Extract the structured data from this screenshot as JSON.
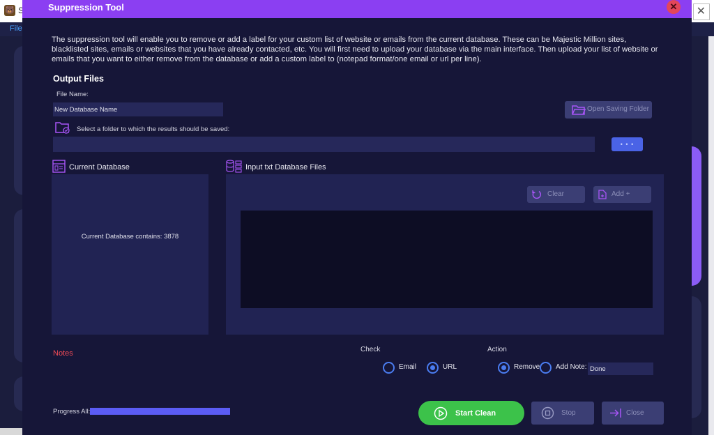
{
  "background_app": {
    "title_initial": "S",
    "menu_file": "File"
  },
  "dialog": {
    "title": "Suppression Tool",
    "description": "The suppression tool will enable you to remove or add a label for your custom list of website or emails from the current database. These can be Majestic Million sites, blacklisted sites, emails or websites that you have already contacted, etc. You will first need to upload your database via the main interface. Then upload your list of website or emails that you want to either remove from the database or add a custom label to (notepad format/one email or url per line).",
    "output_files": {
      "title": "Output Files",
      "file_name_label": "File Name:",
      "file_name_value": "New Database Name",
      "open_saving_folder_label": "Open Saving Folder",
      "folder_prompt": "Select a folder to which the results should be saved:",
      "folder_path_value": "",
      "browse_label": "• • •"
    },
    "current_database": {
      "title": "Current Database",
      "count_text": "Current Database contains: 3878"
    },
    "input_files": {
      "title": "Input txt Database Files",
      "clear_label": "Clear",
      "add_label": "Add +"
    },
    "notes_label": "Notes",
    "check": {
      "label": "Check",
      "options": [
        {
          "label": "Email",
          "checked": false
        },
        {
          "label": "URL",
          "checked": true
        }
      ]
    },
    "action": {
      "label": "Action",
      "options": [
        {
          "label": "Remove",
          "checked": true
        },
        {
          "label": "Add Note:",
          "checked": false
        }
      ],
      "note_value": "Done"
    },
    "progress": {
      "label": "Progress All:",
      "value_percent": 100
    },
    "buttons": {
      "start_clean": "Start Clean",
      "stop": "Stop",
      "close": "Close"
    }
  },
  "colors": {
    "title_bar": "#8b3ff2",
    "dialog_bg": "#161638",
    "panel_bg": "#212353",
    "accent_blue": "#4a7cf0",
    "start_green": "#3cc24a",
    "notes_red": "#f04b56",
    "progress_fill": "#5b5cf5"
  },
  "icons": [
    "close-icon",
    "folder-open-icon",
    "folder-select-icon",
    "database-icon",
    "database-files-icon",
    "refresh-icon",
    "add-file-icon",
    "play-icon",
    "stop-icon",
    "exit-icon"
  ]
}
